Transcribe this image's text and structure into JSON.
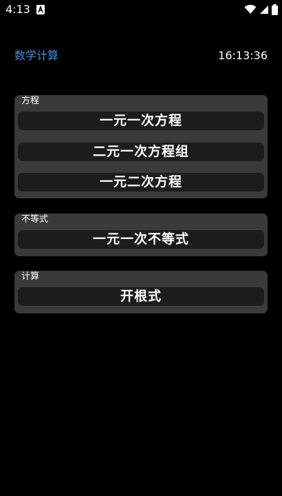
{
  "status_bar": {
    "time": "4:13",
    "app_badge_icon": "a-text-icon",
    "wifi_icon": "wifi-icon",
    "signal_icon": "cell-signal-icon",
    "battery_icon": "battery-icon"
  },
  "header": {
    "title": "数学计算",
    "clock": "16:13:36",
    "title_color": "#3d8fe0"
  },
  "groups": [
    {
      "label": "方程",
      "buttons": [
        "一元一次方程",
        "二元一次方程组",
        "一元二次方程"
      ]
    },
    {
      "label": "不等式",
      "buttons": [
        "一元一次不等式"
      ]
    },
    {
      "label": "计算",
      "buttons": [
        "开根式"
      ]
    }
  ],
  "colors": {
    "background": "#000000",
    "group_background": "#3a3a3a",
    "button_background": "#1c1c1c"
  }
}
